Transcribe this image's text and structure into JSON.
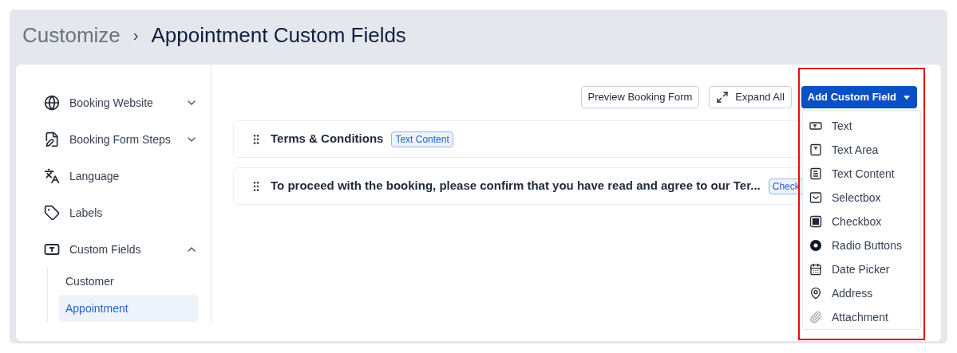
{
  "breadcrumb": {
    "parent": "Customize",
    "separator": "›",
    "current": "Appointment Custom Fields"
  },
  "sidebar": {
    "items": [
      {
        "label": "Booking Website",
        "kind": "globe",
        "expanded": false
      },
      {
        "label": "Booking Form Steps",
        "kind": "form",
        "expanded": false
      },
      {
        "label": "Language",
        "kind": "language"
      },
      {
        "label": "Labels",
        "kind": "tag"
      },
      {
        "label": "Custom Fields",
        "kind": "field",
        "expanded": true,
        "children": [
          {
            "label": "Customer",
            "selected": false
          },
          {
            "label": "Appointment",
            "selected": true
          }
        ]
      }
    ]
  },
  "toolbar": {
    "preview_button": "Preview Booking Form",
    "expand_button": "Expand All",
    "add_button": "Add Custom Field"
  },
  "fields": [
    {
      "title": "Terms & Conditions",
      "badge": "Text Content"
    },
    {
      "title": "To proceed with the booking, please confirm that you have read and agree to our Ter...",
      "badge": "Check"
    }
  ],
  "add_menu": {
    "items": [
      {
        "label": "Text",
        "kind": "text"
      },
      {
        "label": "Text Area",
        "kind": "textarea"
      },
      {
        "label": "Text Content",
        "kind": "content"
      },
      {
        "label": "Selectbox",
        "kind": "select"
      },
      {
        "label": "Checkbox",
        "kind": "checkbox"
      },
      {
        "label": "Radio Buttons",
        "kind": "radio"
      },
      {
        "label": "Date Picker",
        "kind": "date"
      },
      {
        "label": "Address",
        "kind": "address"
      },
      {
        "label": "Attachment",
        "kind": "attachment"
      }
    ]
  },
  "highlight": {
    "on": true
  }
}
